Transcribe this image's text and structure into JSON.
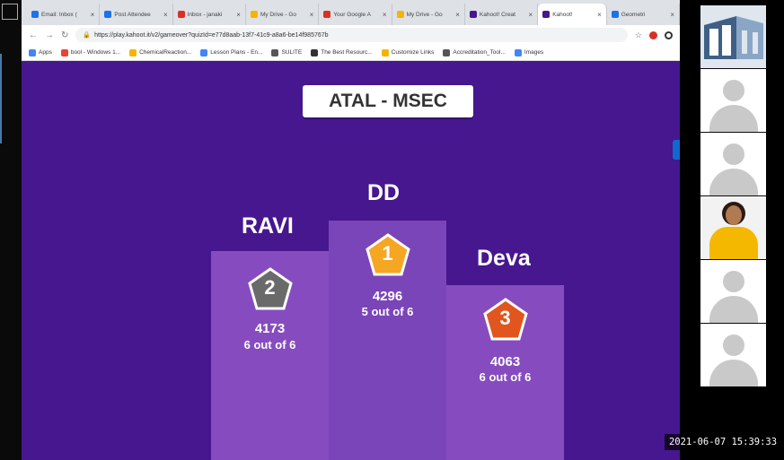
{
  "browser": {
    "tabs": [
      {
        "label": "Email: Inbox (",
        "color": "#1a73e8",
        "active": false
      },
      {
        "label": "Post Attendee",
        "color": "#1a73e8",
        "active": false
      },
      {
        "label": "Inbox - janaki",
        "color": "#d93025",
        "active": false
      },
      {
        "label": "My Drive - Go",
        "color": "#f4b400",
        "active": false
      },
      {
        "label": "Your Google A",
        "color": "#d93025",
        "active": false
      },
      {
        "label": "My Drive - Go",
        "color": "#f4b400",
        "active": false
      },
      {
        "label": "Kahoot! Creat",
        "color": "#46178f",
        "active": false
      },
      {
        "label": "Kahoot!",
        "color": "#46178f",
        "active": true
      },
      {
        "label": "Geometri",
        "color": "#1a73e8",
        "active": false
      }
    ],
    "url": "https://play.kahoot.it/v2/gameover?quizId=e77d8aab-13f7-41c9-a8a6-be14f985767b",
    "bookmarks": [
      {
        "label": "Apps",
        "color": "#4285f4"
      },
      {
        "label": "bool - Windows 1...",
        "color": "#ea4335"
      },
      {
        "label": "ChemicalReaction...",
        "color": "#f4b400"
      },
      {
        "label": "Lesson Plans - En...",
        "color": "#4285f4"
      },
      {
        "label": "SULITE",
        "color": "#555555"
      },
      {
        "label": "The Best Resourc...",
        "color": "#333333"
      },
      {
        "label": "Customize Links",
        "color": "#f4b400"
      },
      {
        "label": "Accreditation_Tool...",
        "color": "#555555"
      },
      {
        "label": "Images",
        "color": "#4285f4"
      }
    ]
  },
  "game": {
    "title": "ATAL - MSEC",
    "podium": [
      {
        "rank": "2",
        "name": "RAVI",
        "score": "4173",
        "correct": "6 out of 6",
        "badge_color": "#6a6a6a"
      },
      {
        "rank": "1",
        "name": "DD",
        "score": "4296",
        "correct": "5 out of 6",
        "badge_color": "#f5a623"
      },
      {
        "rank": "3",
        "name": "Deva",
        "score": "4063",
        "correct": "6 out of 6",
        "badge_color": "#e0561e"
      }
    ]
  },
  "timestamp": "2021-06-07  15:39:33",
  "colors": {
    "page_bg": "#46178f",
    "podium": "#864cbf"
  }
}
